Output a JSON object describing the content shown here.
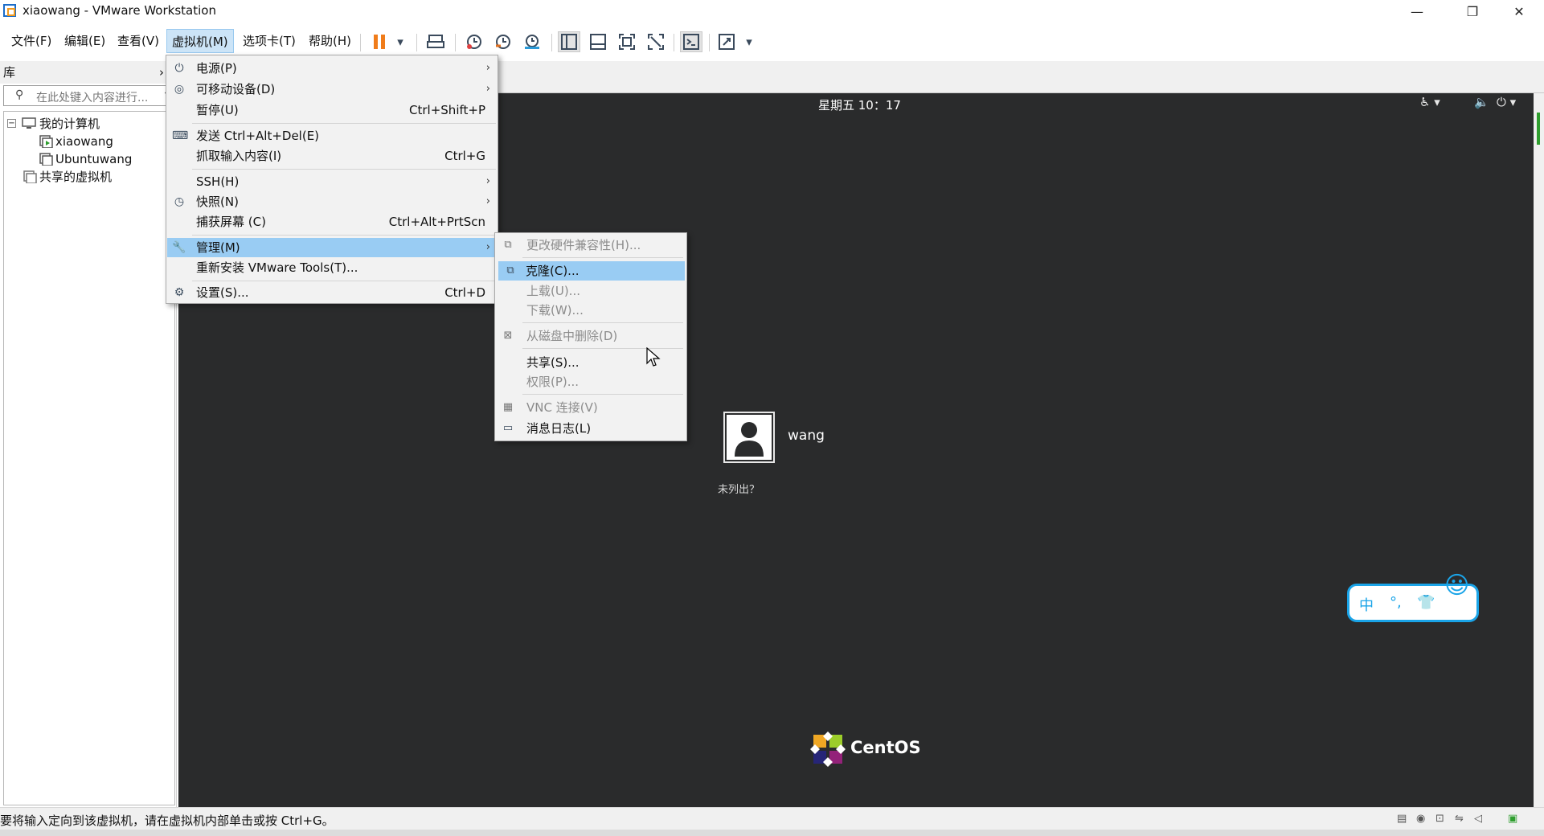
{
  "window": {
    "title": "xiaowang - VMware Workstation",
    "minimize_glyph": "—",
    "restore_glyph": "❐",
    "close_glyph": "✕"
  },
  "menubar": {
    "file": "文件(F)",
    "edit": "编辑(E)",
    "view": "查看(V)",
    "vm": "虚拟机(M)",
    "tabs": "选项卡(T)",
    "help": "帮助(H)"
  },
  "library": {
    "header": "库",
    "search_placeholder": "在此处键入内容进行...",
    "tree": {
      "my_computer": "我的计算机",
      "vm1": "xiaowang",
      "vm2": "Ubuntuwang",
      "shared": "共享的虚拟机"
    }
  },
  "vm_menu": {
    "power": "电源(P)",
    "removable": "可移动设备(D)",
    "pause": "暂停(U)",
    "pause_shortcut": "Ctrl+Shift+P",
    "send_cad": "发送 Ctrl+Alt+Del(E)",
    "grab_input": "抓取输入内容(I)",
    "grab_shortcut": "Ctrl+G",
    "ssh": "SSH(H)",
    "snapshot": "快照(N)",
    "capture_screen": "捕获屏幕 (C)",
    "capture_shortcut": "Ctrl+Alt+PrtScn",
    "manage": "管理(M)",
    "reinstall_tools": "重新安装 VMware Tools(T)...",
    "settings": "设置(S)...",
    "settings_shortcut": "Ctrl+D"
  },
  "manage_submenu": {
    "change_hw": "更改硬件兼容性(H)...",
    "clone": "克隆(C)...",
    "upload": "上载(U)...",
    "download": "下载(W)...",
    "delete_from_disk": "从磁盘中删除(D)",
    "share": "共享(S)...",
    "permissions": "权限(P)...",
    "vnc": "VNC 连接(V)",
    "message_log": "消息日志(L)"
  },
  "guest": {
    "clock": "星期五 10：17",
    "username": "wang",
    "not_listed": "未列出？",
    "logo_text": "CentOS",
    "ime_text": "中",
    "ime_punct": "°,"
  },
  "statusbar": {
    "message": "要将输入定向到该虚拟机，请在虚拟机内部单击或按 Ctrl+G。"
  },
  "colors": {
    "menu_highlight": "#99ccf3",
    "vm_background": "#2a2b2c",
    "pause_orange": "#f07c1a",
    "ime_blue": "#1aa4e8"
  }
}
